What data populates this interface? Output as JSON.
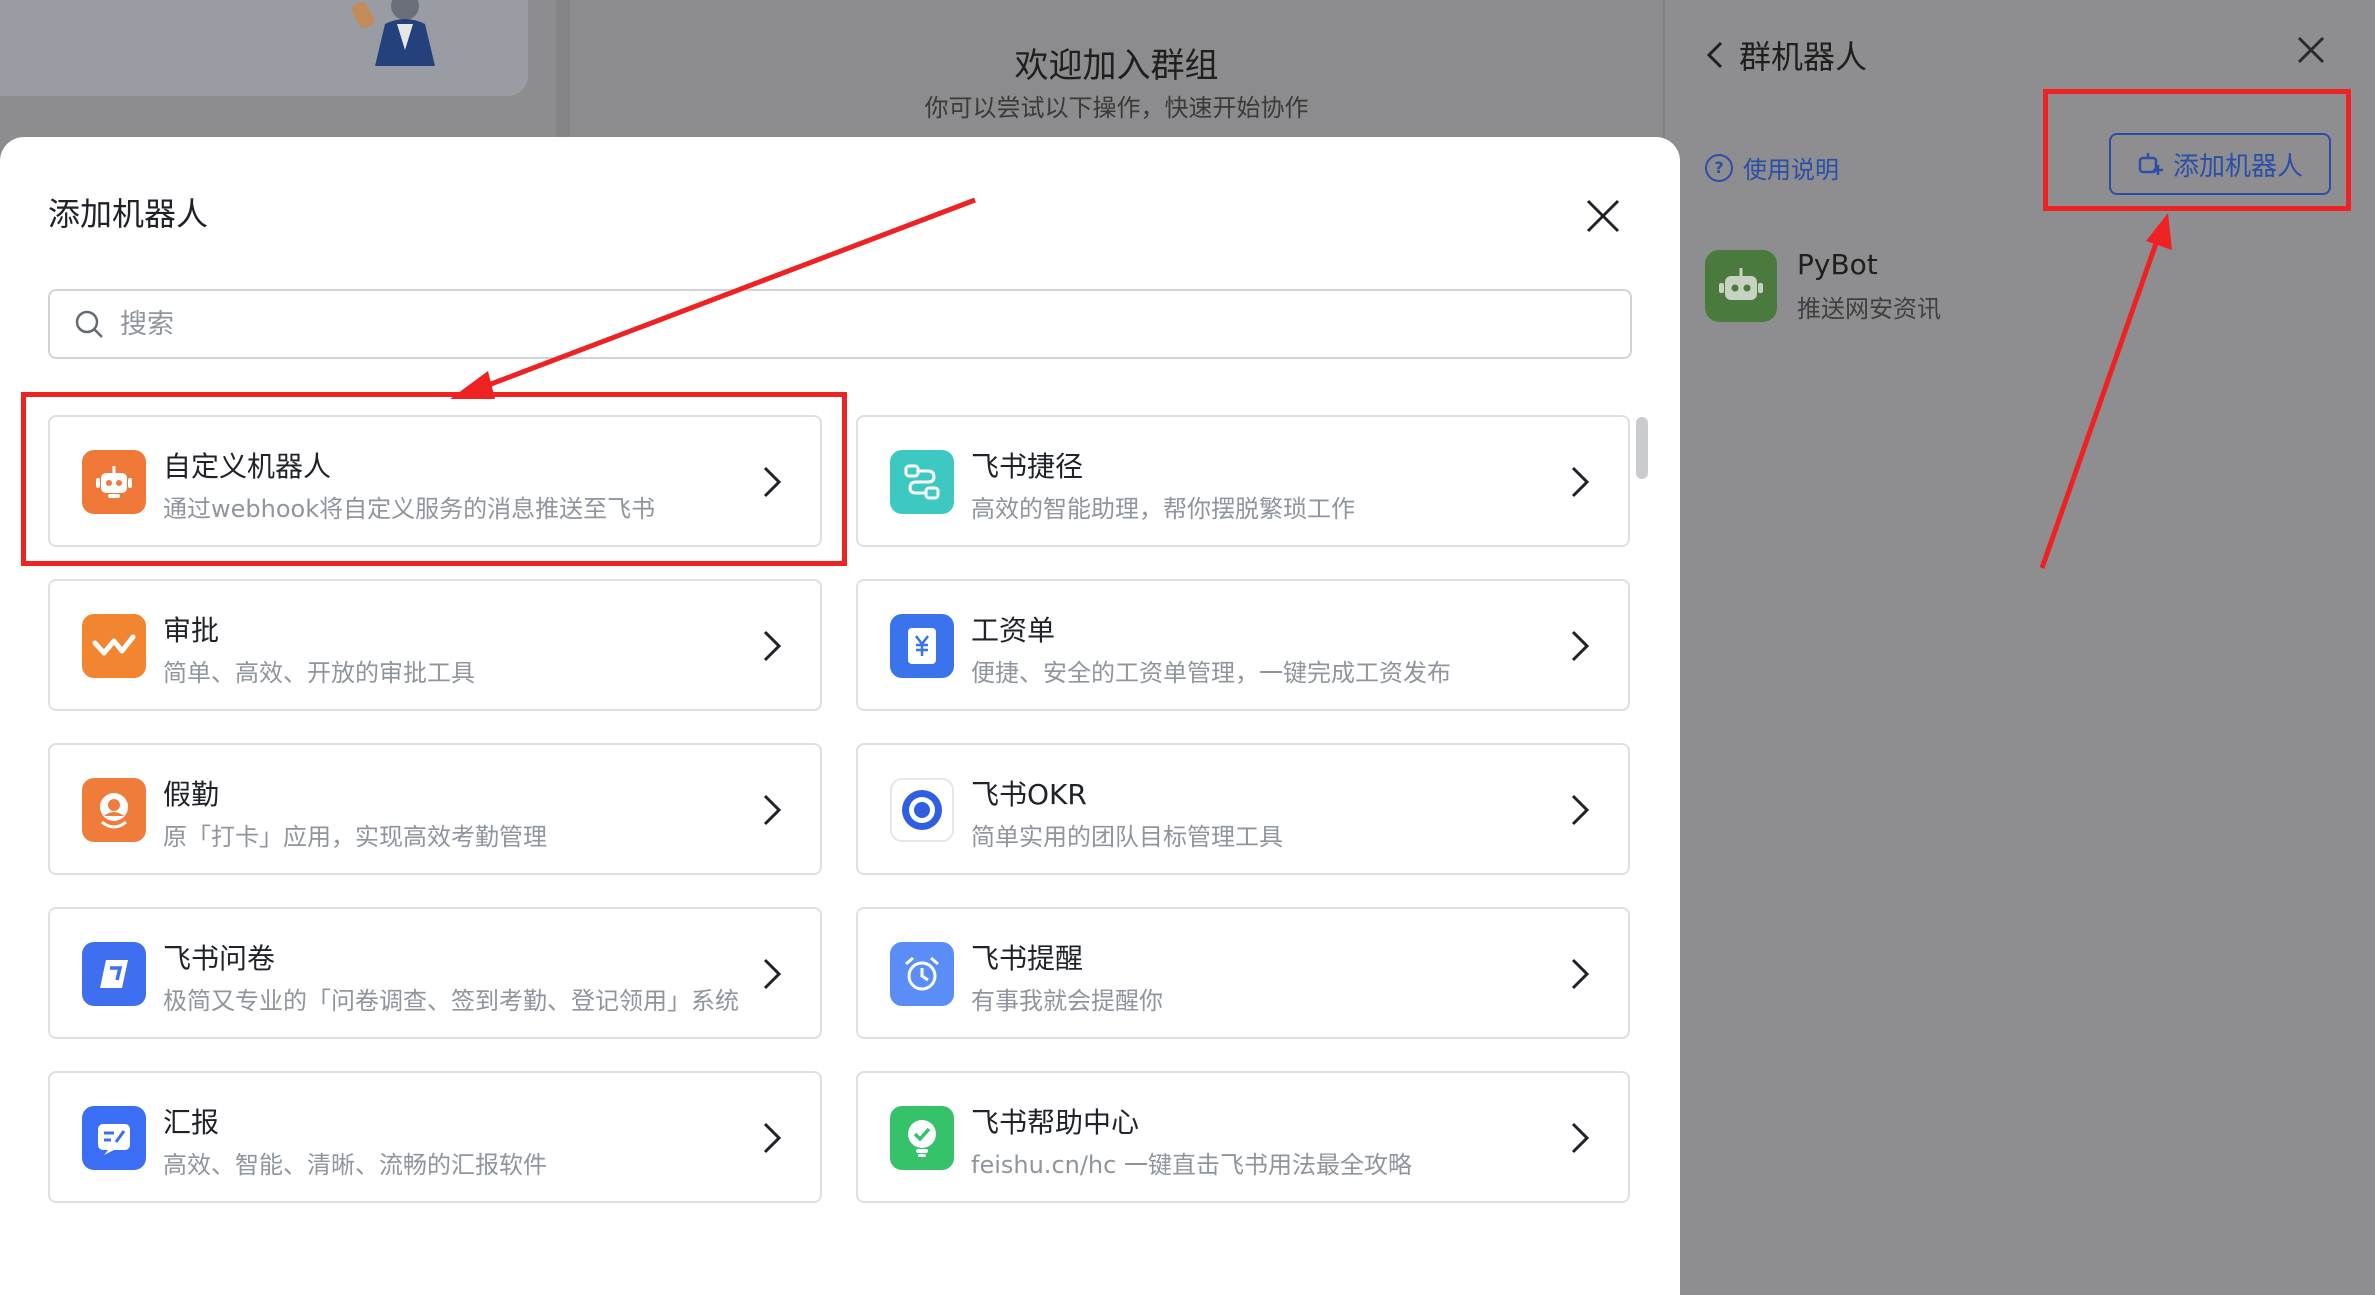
{
  "background": {
    "welcome_title": "欢迎加入群组",
    "welcome_subtitle": "你可以尝试以下操作，快速开始协作"
  },
  "right_panel": {
    "title": "群机器人",
    "help_label": "使用说明",
    "add_button_label": "添加机器人",
    "bot": {
      "name": "PyBot",
      "description": "推送网安资讯"
    }
  },
  "modal": {
    "title": "添加机器人",
    "search": {
      "placeholder": "搜索",
      "value": ""
    },
    "cards": [
      {
        "title": "自定义机器人",
        "description": "通过webhook将自定义服务的消息推送至飞书",
        "icon": "robot-icon",
        "color": "#f0793a"
      },
      {
        "title": "飞书捷径",
        "description": "高效的智能助理，帮你摆脱繁琐工作",
        "icon": "shortcut-flow-icon",
        "color": "#3dc9c1"
      },
      {
        "title": "审批",
        "description": "简单、高效、开放的审批工具",
        "icon": "approval-check-icon",
        "color": "#f2852f"
      },
      {
        "title": "工资单",
        "description": "便捷、安全的工资单管理，一键完成工资发布",
        "icon": "payroll-yen-icon",
        "color": "#3b73ec"
      },
      {
        "title": "假勤",
        "description": "原「打卡」应用，实现高效考勤管理",
        "icon": "attendance-pin-icon",
        "color": "#f07c3c"
      },
      {
        "title": "飞书OKR",
        "description": "简单实用的团队目标管理工具",
        "icon": "okr-target-icon",
        "color": "#2f5fe0"
      },
      {
        "title": "飞书问卷",
        "description": "极简又专业的「问卷调查、签到考勤、登记领用」系统",
        "icon": "survey-icon",
        "color": "#3d6ff0"
      },
      {
        "title": "飞书提醒",
        "description": "有事我就会提醒你",
        "icon": "alarm-clock-icon",
        "color": "#5b8df6"
      },
      {
        "title": "汇报",
        "description": "高效、智能、清晰、流畅的汇报软件",
        "icon": "report-icon",
        "color": "#3a6ff5"
      },
      {
        "title": "飞书帮助中心",
        "description": "feishu.cn/hc 一键直击飞书用法最全攻略",
        "icon": "help-center-bulb-icon",
        "color": "#35c26b"
      }
    ]
  },
  "annotation_color": "#ee2222"
}
